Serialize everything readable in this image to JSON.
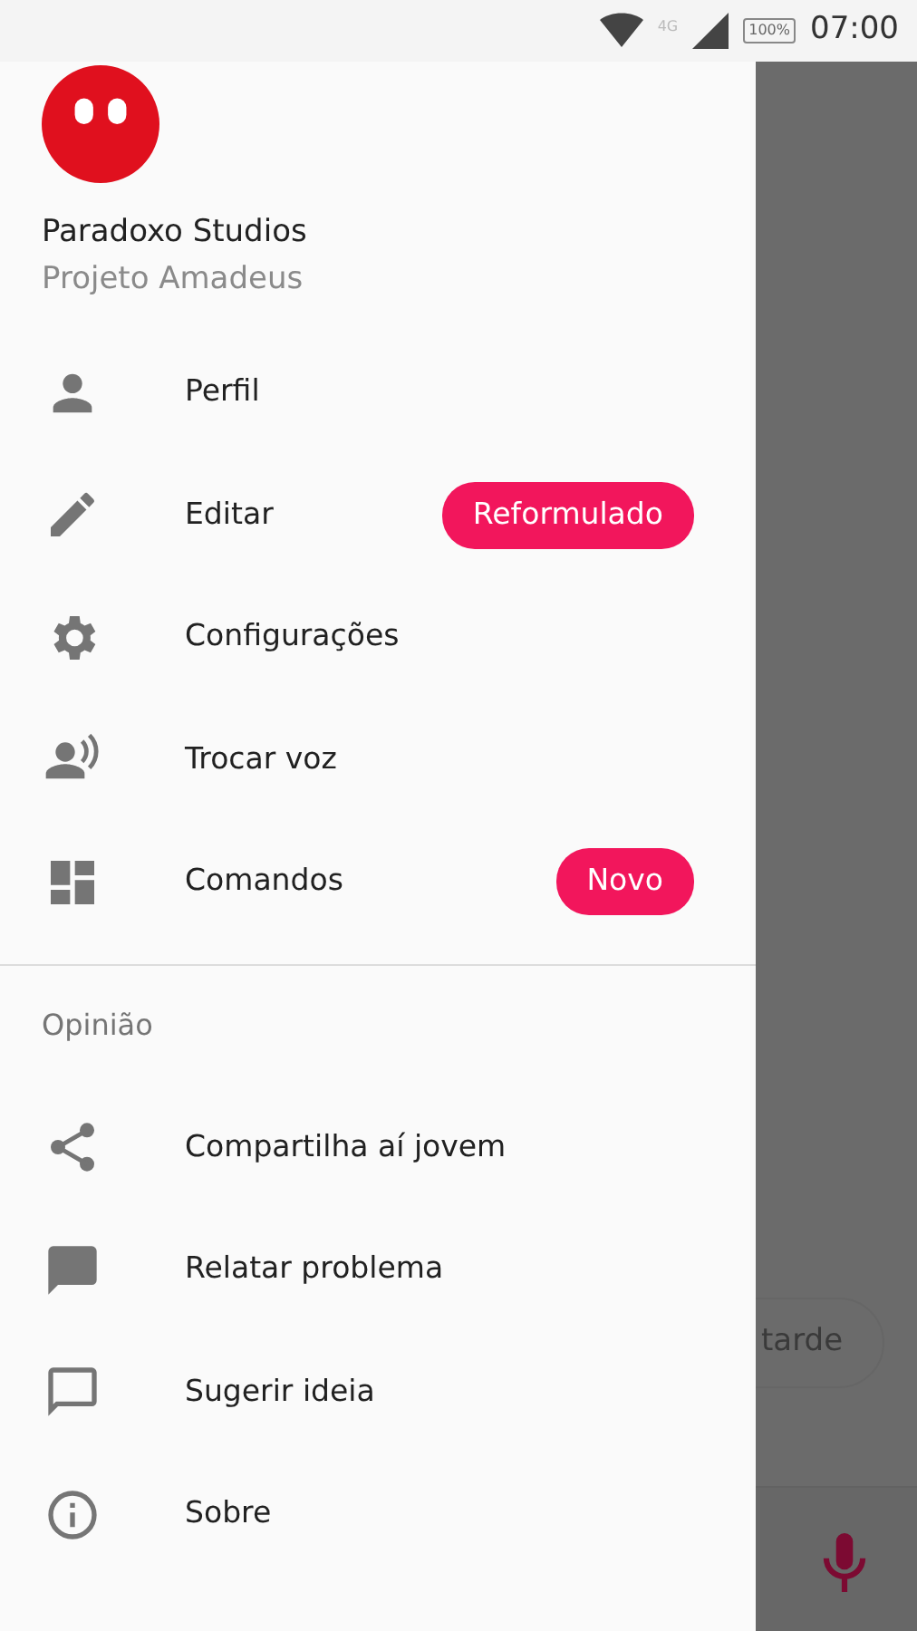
{
  "status_bar": {
    "network": "4G",
    "battery": "100%",
    "time": "07:00"
  },
  "header": {
    "title": "Paradoxo Studios",
    "subtitle": "Projeto Amadeus"
  },
  "menu": [
    {
      "label": "Perfil"
    },
    {
      "label": "Editar",
      "badge": "Reformulado"
    },
    {
      "label": "Configurações"
    },
    {
      "label": "Trocar voz"
    },
    {
      "label": "Comandos",
      "badge": "Novo"
    }
  ],
  "section": {
    "title": "Opinião",
    "items": [
      {
        "label": "Compartilha aí jovem"
      },
      {
        "label": "Relatar problema"
      },
      {
        "label": "Sugerir ideia"
      },
      {
        "label": "Sobre"
      }
    ]
  },
  "background": {
    "chip": "tarde"
  }
}
